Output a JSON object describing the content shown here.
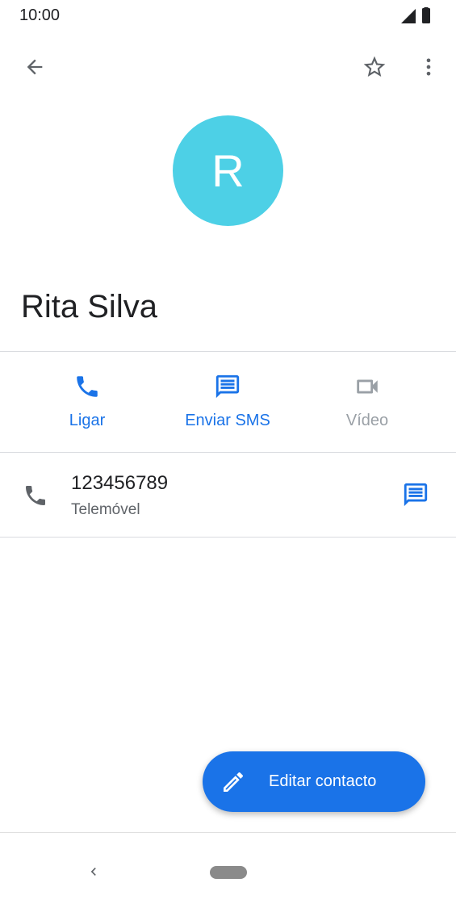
{
  "status_bar": {
    "time": "10:00"
  },
  "toolbar": {
    "back_icon": "arrow-left-icon",
    "favorite_icon": "star-outline-icon",
    "more_icon": "more-vert-icon"
  },
  "contact": {
    "initial": "R",
    "avatar_color": "#4dd0e6",
    "name": "Rita Silva"
  },
  "actions": [
    {
      "label": "Ligar",
      "icon": "phone-icon",
      "color": "#1a73e8",
      "enabled": true
    },
    {
      "label": "Enviar SMS",
      "icon": "message-icon",
      "color": "#1a73e8",
      "enabled": true
    },
    {
      "label": "Vídeo",
      "icon": "video-icon",
      "color": "#9aa0a6",
      "enabled": false
    }
  ],
  "phone_entry": {
    "number": "123456789",
    "type": "Telemóvel",
    "leading_icon": "phone-icon",
    "trailing_icon": "message-icon"
  },
  "fab": {
    "label": "Editar contacto",
    "icon": "pencil-icon",
    "color": "#1a73e8"
  },
  "nav_bar": {
    "back_icon": "nav-back-icon",
    "home_icon": "home-pill-icon"
  }
}
